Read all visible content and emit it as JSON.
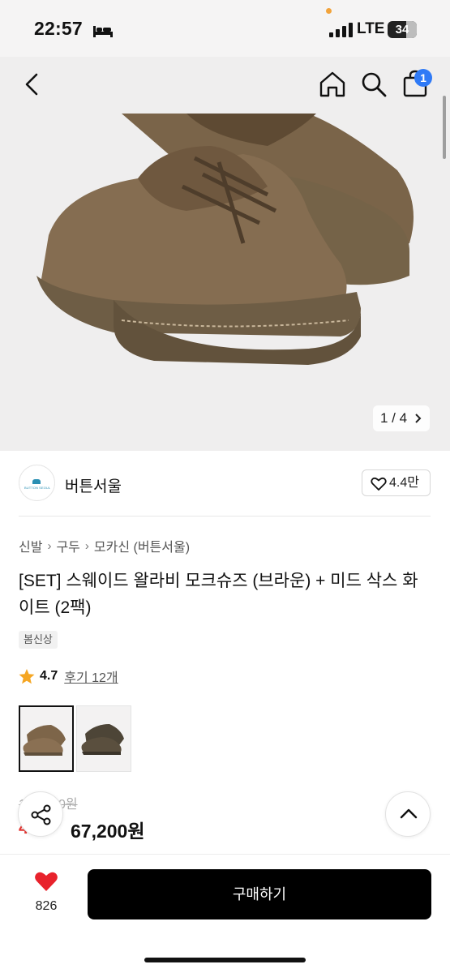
{
  "status_bar": {
    "time": "22:57",
    "network": "LTE",
    "battery": "34",
    "icons": [
      "sleep-bed-icon",
      "signal-bars-icon",
      "battery-icon"
    ]
  },
  "top_nav": {
    "icons": [
      "back-chevron-icon",
      "home-icon",
      "search-icon",
      "shopping-bag-icon"
    ],
    "cart_count": "1",
    "badge_color": "#2f7af6"
  },
  "gallery": {
    "pager": "1 / 4",
    "pager_icon": "chevron-right-icon"
  },
  "shop": {
    "logo_text": "BUTTON SEOUL",
    "name": "버튼서울",
    "likes": "4.4만",
    "like_icon": "heart-outline-icon"
  },
  "breadcrumb": [
    "신발",
    "구두",
    "모카신 (버튼서울)"
  ],
  "product": {
    "title": "[SET] 스웨이드 왈라비 모크슈즈 (브라운) + 미드 삭스 화이트 (2팩)",
    "tag": "봄신상",
    "rating": "4.7",
    "reviews": "후기 12개",
    "rating_color": "#f5a623",
    "original_price": "1",
    "original_price_tail": "0원",
    "discount": "4",
    "price": "67,200원",
    "discount_color": "#e53935"
  },
  "bottom_bar": {
    "wish_count": "826",
    "buy_label": "구매하기",
    "heart_color": "#e8222c"
  }
}
